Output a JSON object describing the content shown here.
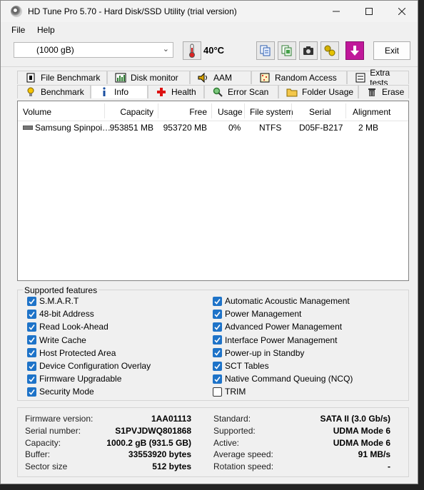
{
  "window": {
    "title": "HD Tune Pro 5.70 - Hard Disk/SSD Utility (trial version)"
  },
  "menu": [
    {
      "label": "File"
    },
    {
      "label": "Help"
    }
  ],
  "toolbar": {
    "drive": "(1000 gB)",
    "temperature": "40°C",
    "exit_label": "Exit"
  },
  "tabs_row1": [
    {
      "label": "File Benchmark",
      "icon": "file-benchmark-icon"
    },
    {
      "label": "Disk monitor",
      "icon": "disk-monitor-icon"
    },
    {
      "label": "AAM",
      "icon": "speaker-icon"
    },
    {
      "label": "Random Access",
      "icon": "random-access-icon"
    },
    {
      "label": "Extra tests",
      "icon": "extra-tests-icon"
    }
  ],
  "tabs_row2": [
    {
      "label": "Benchmark",
      "icon": "lightbulb-icon"
    },
    {
      "label": "Info",
      "icon": "info-icon"
    },
    {
      "label": "Health",
      "icon": "health-cross-icon"
    },
    {
      "label": "Error Scan",
      "icon": "magnifier-icon"
    },
    {
      "label": "Folder Usage",
      "icon": "folder-icon"
    },
    {
      "label": "Erase",
      "icon": "trash-icon"
    }
  ],
  "volume_table": {
    "columns": [
      "Volume",
      "Capacity",
      "Free",
      "Usage",
      "File system",
      "Serial",
      "Alignment"
    ],
    "rows": [
      {
        "volume": "Samsung Spinpoi…",
        "capacity": "953851 MB",
        "free": "953720 MB",
        "usage": "0%",
        "file_system": "NTFS",
        "serial": "D05F-B217",
        "alignment": "2 MB"
      }
    ]
  },
  "features": {
    "label": "Supported features",
    "left": [
      {
        "label": "S.M.A.R.T",
        "checked": true
      },
      {
        "label": "48-bit Address",
        "checked": true
      },
      {
        "label": "Read Look-Ahead",
        "checked": true
      },
      {
        "label": "Write Cache",
        "checked": true
      },
      {
        "label": "Host Protected Area",
        "checked": true
      },
      {
        "label": "Device Configuration Overlay",
        "checked": true
      },
      {
        "label": "Firmware Upgradable",
        "checked": true
      },
      {
        "label": "Security Mode",
        "checked": true
      }
    ],
    "right": [
      {
        "label": "Automatic Acoustic Management",
        "checked": true
      },
      {
        "label": "Power Management",
        "checked": true
      },
      {
        "label": "Advanced Power Management",
        "checked": true
      },
      {
        "label": "Interface Power Management",
        "checked": true
      },
      {
        "label": "Power-up in Standby",
        "checked": true
      },
      {
        "label": "SCT Tables",
        "checked": true
      },
      {
        "label": "Native Command Queuing (NCQ)",
        "checked": true
      },
      {
        "label": "TRIM",
        "checked": false
      }
    ]
  },
  "info": {
    "left": [
      {
        "label": "Firmware version:",
        "value": "1AA01113"
      },
      {
        "label": "Serial number:",
        "value": "S1PVJDWQ801868"
      },
      {
        "label": "Capacity:",
        "value": "1000.2 gB (931.5 GB)"
      },
      {
        "label": "Buffer:",
        "value": "33553920 bytes"
      },
      {
        "label": "Sector size",
        "value": "512 bytes"
      }
    ],
    "right": [
      {
        "label": "Standard:",
        "value": "SATA II (3.0 Gb/s)"
      },
      {
        "label": "Supported:",
        "value": "UDMA Mode 6"
      },
      {
        "label": "Active:",
        "value": "UDMA Mode 6"
      },
      {
        "label": "Average speed:",
        "value": "91 MB/s"
      },
      {
        "label": "Rotation speed:",
        "value": "-"
      }
    ]
  },
  "colors": {
    "accent": "#1e73c8",
    "exit_icon": "#c0189a"
  }
}
